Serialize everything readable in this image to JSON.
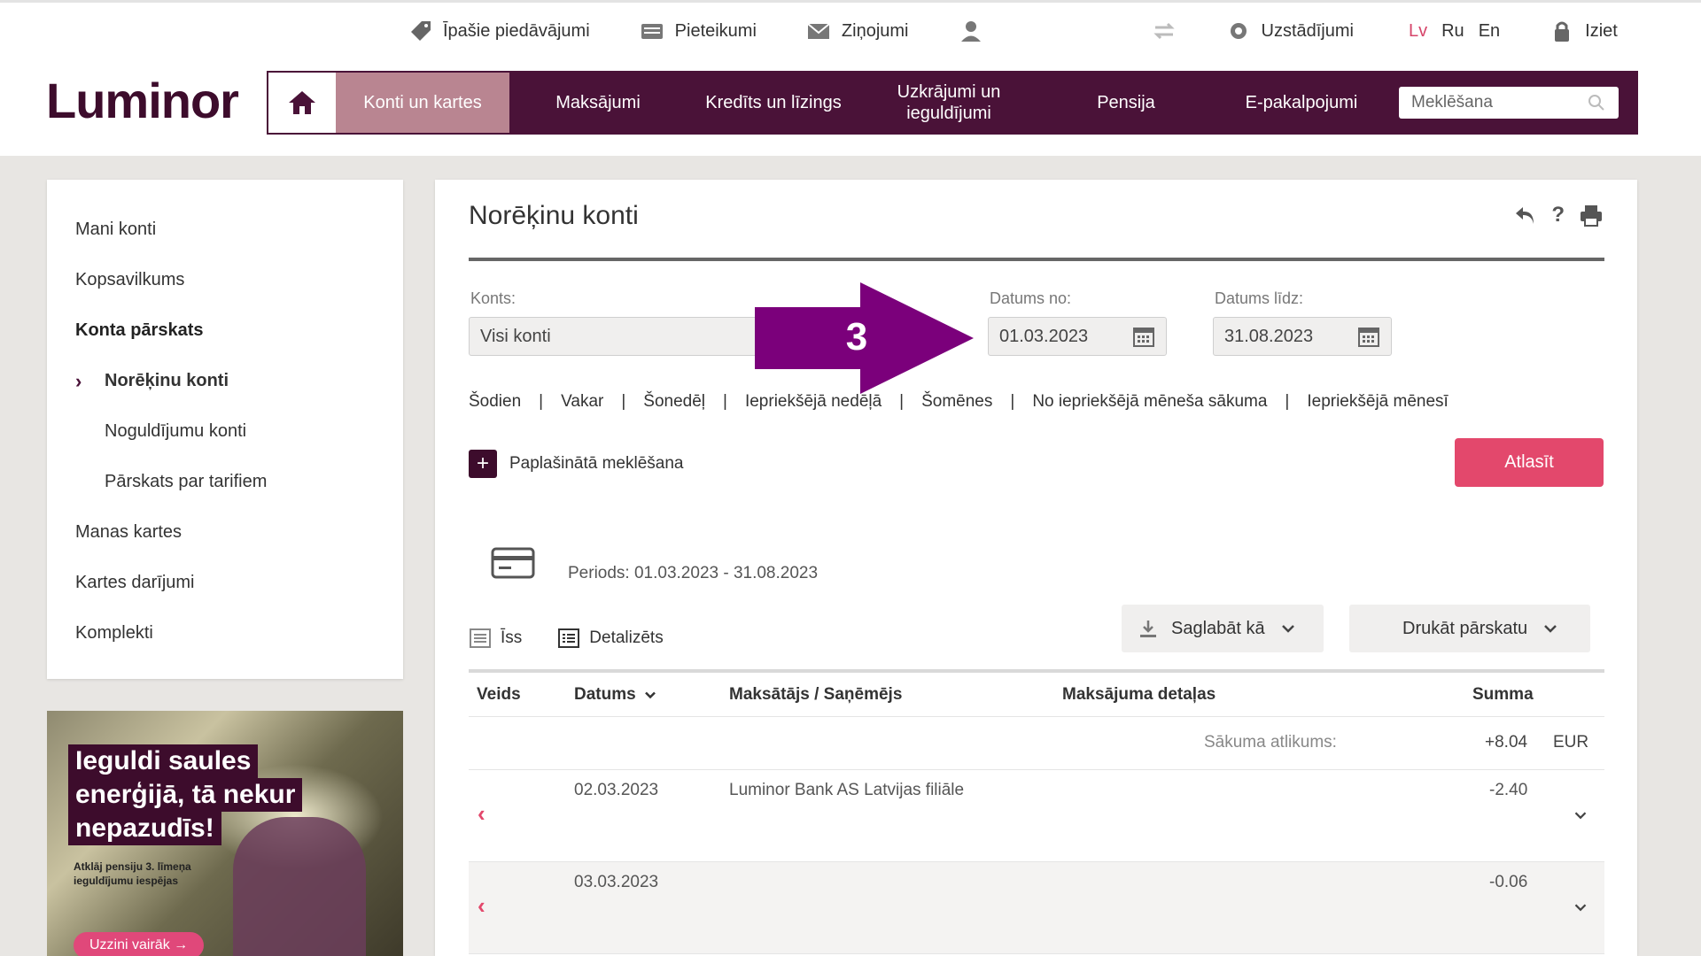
{
  "topbar": {
    "offers": "Īpašie piedāvājumi",
    "applications": "Pieteikumi",
    "messages": "Ziņojumi",
    "settings": "Uzstādījumi",
    "lang_lv": "Lv",
    "lang_ru": "Ru",
    "lang_en": "En",
    "logout": "Iziet"
  },
  "logo": "Luminor",
  "nav": {
    "items": [
      "Konti un kartes",
      "Maksājumi",
      "Kredīts un līzings",
      "Uzkrājumi un ieguldījumi",
      "Pensija",
      "E-pakalpojumi"
    ],
    "search_placeholder": "Meklēšana"
  },
  "sidebar": {
    "items": [
      "Mani konti",
      "Kopsavilkums",
      "Konta pārskats",
      "Norēķinu konti",
      "Noguldījumu konti",
      "Pārskats par tarifiem",
      "Manas kartes",
      "Kartes darījumi",
      "Komplekti"
    ]
  },
  "banner": {
    "line1": "Ieguldi saules",
    "line2": "enerģijā, tā nekur",
    "line3": "nepazudīs!",
    "small": "Atklāj pensiju 3. līmeņa ieguldījumu iespējas",
    "cta": "Uzzini vairāk →"
  },
  "main": {
    "title": "Norēķinu konti",
    "account_label": "Konts:",
    "account_value": "Visi konti",
    "date_from_label": "Datums no:",
    "date_from": "01.03.2023",
    "date_to_label": "Datums līdz:",
    "date_to": "31.08.2023",
    "annotation": "3",
    "quick": [
      "Šodien",
      "Vakar",
      "Šonedēļ",
      "Iepriekšējā nedēļā",
      "Šomēnes",
      "No iepriekšējā mēneša sākuma",
      "Iepriekšējā mēnesī"
    ],
    "separator": "|",
    "advanced_search": "Paplašinātā meklēšana",
    "select_button": "Atlasīt",
    "period": "Periods: 01.03.2023 - 31.08.2023",
    "view_short": "Īss",
    "view_detailed": "Detalizēts",
    "save_as": "Saglabāt kā",
    "print_report": "Drukāt pārskatu"
  },
  "table": {
    "headers": [
      "Veids",
      "Datums",
      "Maksātājs / Saņēmējs",
      "Maksājuma detaļas",
      "Summa"
    ],
    "opening_label": "Sākuma atlikums:",
    "opening_amount": "+8.04",
    "currency": "EUR",
    "rows": [
      {
        "date": "02.03.2023",
        "party": "Luminor Bank AS Latvijas filiāle",
        "amount": "-2.40"
      },
      {
        "date": "03.03.2023",
        "party": "",
        "amount": "-0.06"
      }
    ]
  },
  "colors": {
    "brand": "#4a1238",
    "accent": "#e3486c",
    "nav_active": "#b98591",
    "arrow": "#7b007b"
  }
}
